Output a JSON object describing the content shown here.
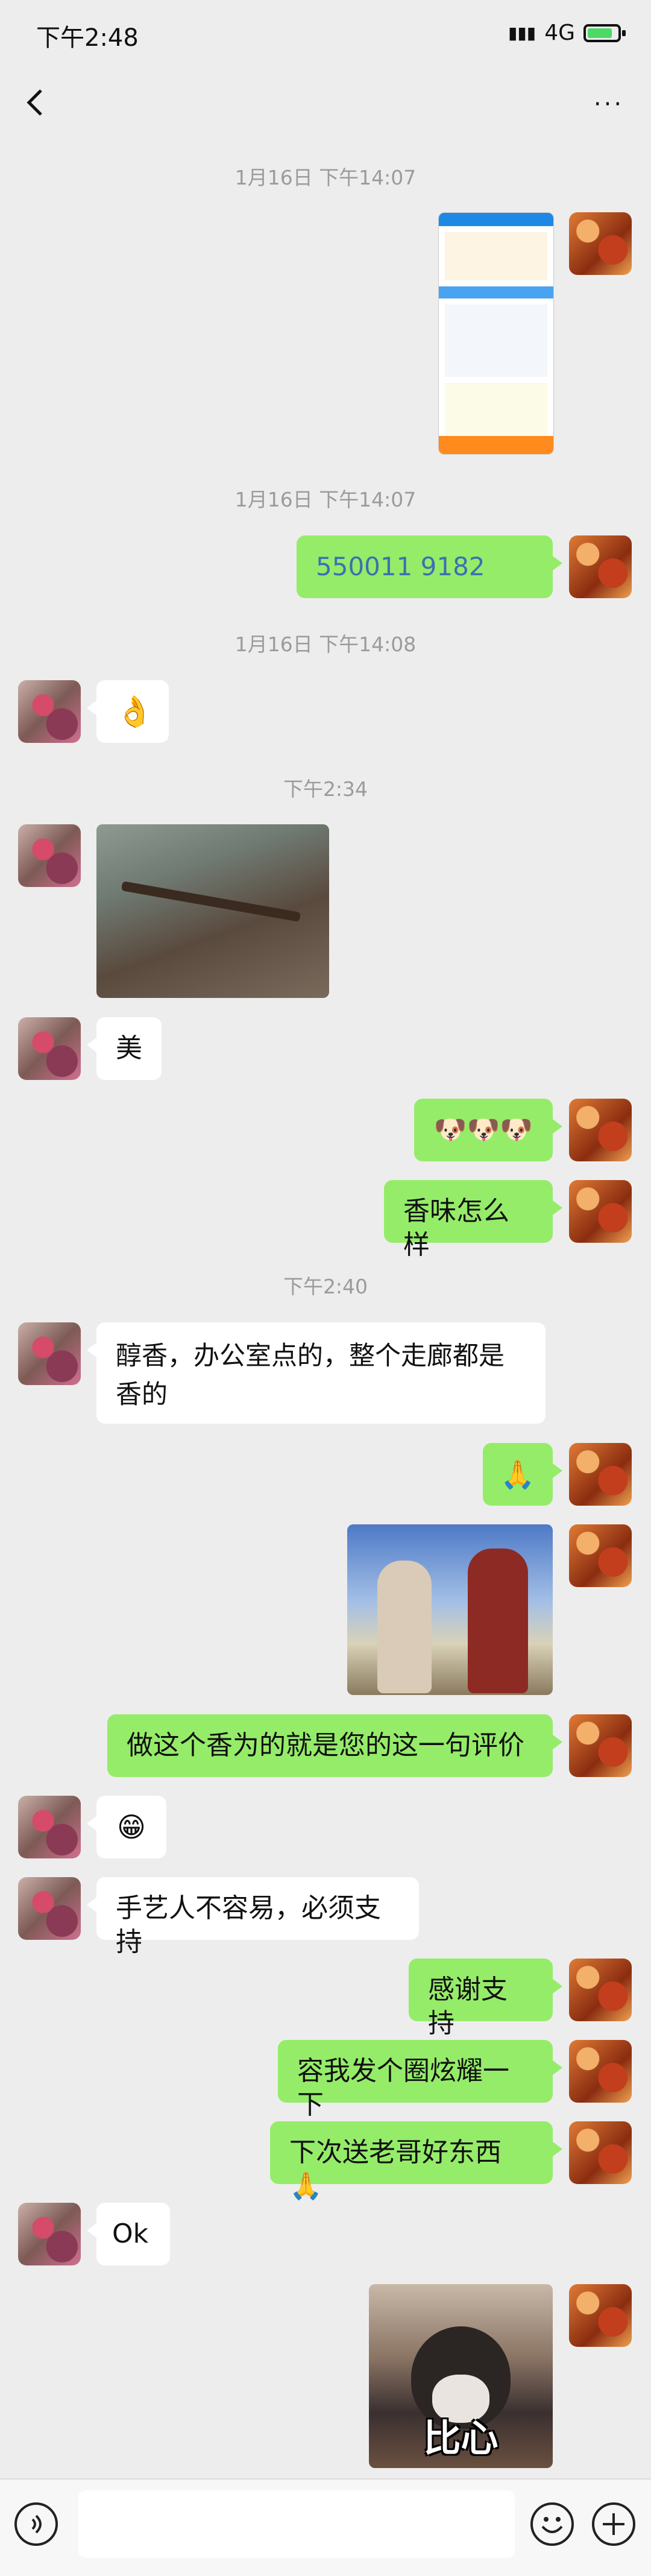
{
  "status_bar": {
    "time": "下午2:48",
    "network": "4G"
  },
  "header": {
    "title": "",
    "back_icon": "chevron-left-icon",
    "more_icon": "more-dots-icon",
    "more_label": "···"
  },
  "messages": [
    {
      "type": "timestamp",
      "text": "1月16日 下午14:07"
    },
    {
      "type": "image",
      "side": "right",
      "description_icon": "screenshot-image"
    },
    {
      "type": "timestamp",
      "text": "1月16日 下午14:07"
    },
    {
      "type": "text",
      "side": "right",
      "text": "550011 9182"
    },
    {
      "type": "timestamp",
      "text": "1月16日 下午14:08"
    },
    {
      "type": "emoji",
      "side": "left",
      "emoji": "👌"
    },
    {
      "type": "timestamp",
      "text": "下午2:34"
    },
    {
      "type": "image",
      "side": "left",
      "description_icon": "incense-photo"
    },
    {
      "type": "text",
      "side": "left",
      "text": "美"
    },
    {
      "type": "emoji",
      "side": "right",
      "emoji": "🐶🐶🐶"
    },
    {
      "type": "text",
      "side": "right",
      "text": "香味怎么样"
    },
    {
      "type": "timestamp",
      "text": "下午2:40"
    },
    {
      "type": "text",
      "side": "left",
      "text": "醇香，办公室点的，整个走廊都是香的"
    },
    {
      "type": "emoji",
      "side": "right",
      "emoji": "🙏"
    },
    {
      "type": "image",
      "side": "right",
      "description_icon": "handshake-photo"
    },
    {
      "type": "text",
      "side": "right",
      "text": "做这个香为的就是您的这一句评价"
    },
    {
      "type": "emoji",
      "side": "left",
      "emoji": "😁"
    },
    {
      "type": "text",
      "side": "left",
      "text": "手艺人不容易，必须支持"
    },
    {
      "type": "text",
      "side": "right",
      "text": "感谢支持"
    },
    {
      "type": "text",
      "side": "right",
      "text": "容我发个圈炫耀一下"
    },
    {
      "type": "text",
      "side": "right",
      "text": "下次送老哥好东西🙏"
    },
    {
      "type": "text",
      "side": "left",
      "text": "Ok"
    },
    {
      "type": "sticker",
      "side": "right",
      "caption": "比心"
    }
  ],
  "input_bar": {
    "voice_icon": "voice-icon",
    "emoji_icon": "emoji-icon",
    "plus_icon": "plus-icon"
  },
  "colors": {
    "sent_bubble": "#95ec69",
    "received_bubble": "#ffffff",
    "background": "#ededed"
  }
}
